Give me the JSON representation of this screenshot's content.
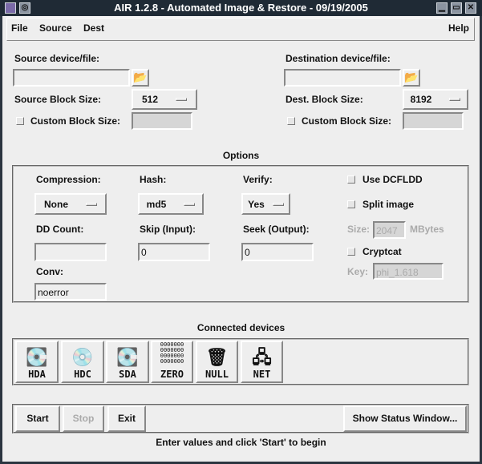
{
  "window": {
    "title": "AIR 1.2.8 - Automated Image & Restore - 09/19/2005"
  },
  "menu": {
    "file": "File",
    "source": "Source",
    "dest": "Dest",
    "help": "Help"
  },
  "source": {
    "label": "Source device/file:",
    "value": "",
    "block_label": "Source Block Size:",
    "block_value": "512",
    "custom_label": "Custom Block Size:",
    "custom_value": ""
  },
  "dest": {
    "label": "Destination device/file:",
    "value": "",
    "block_label": "Dest. Block Size:",
    "block_value": "8192",
    "custom_label": "Custom Block Size:",
    "custom_value": ""
  },
  "options": {
    "title": "Options",
    "compression_label": "Compression:",
    "compression": "None",
    "hash_label": "Hash:",
    "hash": "md5",
    "verify_label": "Verify:",
    "verify": "Yes",
    "ddcount_label": "DD Count:",
    "ddcount": "",
    "skip_label": "Skip (Input):",
    "skip": "0",
    "seek_label": "Seek (Output):",
    "seek": "0",
    "conv_label": "Conv:",
    "conv": "noerror",
    "dcfldd_label": "Use DCFLDD",
    "split_label": "Split image",
    "size_label": "Size:",
    "size": "2047",
    "size_unit": "MBytes",
    "cryptcat_label": "Cryptcat",
    "key_label": "Key:",
    "key": "phi_1.618"
  },
  "devices": {
    "title": "Connected devices",
    "items": [
      {
        "label": "HDA",
        "icon": "hard-disk-icon"
      },
      {
        "label": "HDC",
        "icon": "disc-icon"
      },
      {
        "label": "SDA",
        "icon": "hard-disk-icon"
      },
      {
        "label": "ZERO",
        "icon": "zero-icon"
      },
      {
        "label": "NULL",
        "icon": "trash-icon"
      },
      {
        "label": "NET",
        "icon": "network-icon"
      }
    ]
  },
  "actions": {
    "start": "Start",
    "stop": "Stop",
    "exit": "Exit",
    "status_window": "Show Status Window..."
  },
  "status": "Enter values and click 'Start' to begin"
}
